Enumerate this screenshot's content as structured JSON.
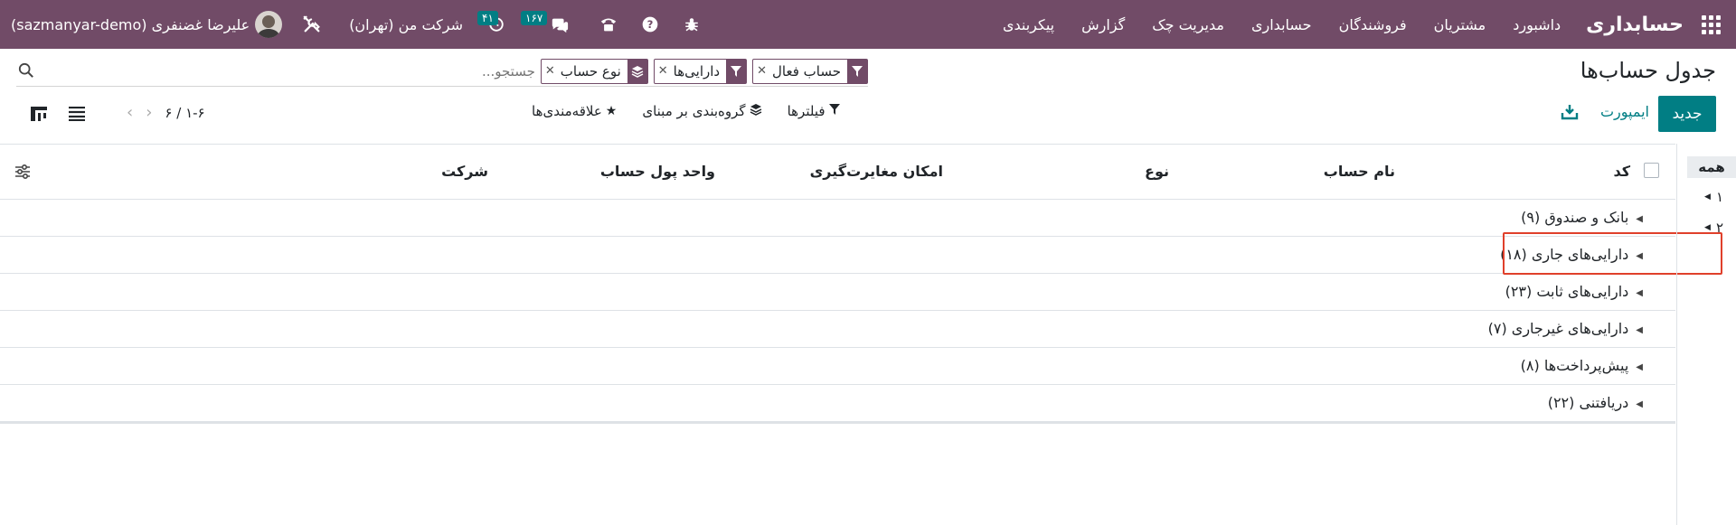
{
  "navbar": {
    "brand": "حسابداری",
    "menu": [
      "داشبورد",
      "مشتریان",
      "فروشندگان",
      "حسابداری",
      "مدیریت چک",
      "گزارش",
      "پیکربندی"
    ],
    "chat_count": "۱۶۷",
    "activity_count": "۴۱",
    "company": "شرکت من (تهران)",
    "user": "علیرضا غضنفری (sazmanyar-demo)"
  },
  "page": {
    "title": "جدول حساب‌ها"
  },
  "search": {
    "facets": [
      {
        "label": "حساب فعال",
        "icon": "filter-icon"
      },
      {
        "label": "دارایی‌ها",
        "icon": "filter-icon"
      },
      {
        "label": "نوع حساب",
        "icon": "layers-icon"
      }
    ],
    "placeholder": "جستجو..."
  },
  "toolbar": {
    "new_label": "جدید",
    "import_label": "ایمپورت",
    "filters_label": "فیلترها",
    "groupby_label": "گروه‌بندی بر مبنای",
    "favorites_label": "علاقه‌مندی‌ها",
    "pager": "۱-۶ / ۶"
  },
  "columns": {
    "code": "کد",
    "name": "نام حساب",
    "type": "نوع",
    "reconcile": "امکان مغایرت‌گیری",
    "currency": "واحد پول حساب",
    "company": "شرکت"
  },
  "groups": [
    {
      "label": "بانک و صندوق (۹)"
    },
    {
      "label": "دارایی‌های جاری (۱۸)"
    },
    {
      "label": "دارایی‌های ثابت (۲۳)"
    },
    {
      "label": "دارایی‌های غیرجاری (۷)"
    },
    {
      "label": "پیش‌پرداخت‌ها (۸)"
    },
    {
      "label": "دریافتنی (۲۲)"
    }
  ],
  "side_panel": {
    "all_label": "همه",
    "items": [
      "۱",
      "۲"
    ]
  },
  "colors": {
    "brand": "#714b67",
    "accent": "#017e84",
    "highlight": "#e0402b"
  }
}
